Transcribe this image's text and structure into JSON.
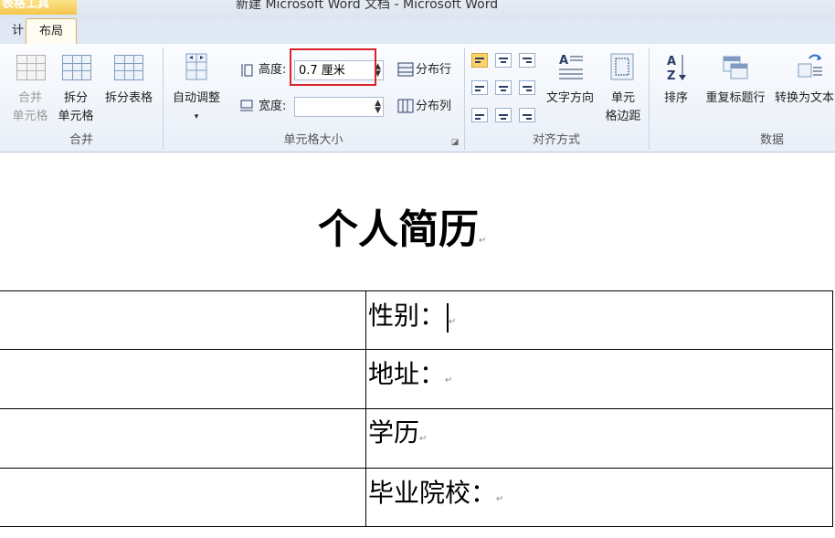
{
  "window": {
    "context_tab": "表格工具",
    "title": "新建 Microsoft Word 文档 - Microsoft Word"
  },
  "tabs": {
    "design": "计",
    "layout": "布局"
  },
  "ribbon": {
    "merge_group": {
      "label": "合并",
      "merge_cells": "合并\n单元格",
      "split_cells": "拆分\n单元格",
      "split_table": "拆分表格"
    },
    "cell_size_group": {
      "label": "单元格大小",
      "autofit": "自动调整",
      "height_label": "高度:",
      "height_value": "0.7 厘米",
      "width_label": "宽度:",
      "width_value": "",
      "distribute_rows": "分布行",
      "distribute_cols": "分布列"
    },
    "alignment_group": {
      "label": "对齐方式",
      "text_direction": "文字方向",
      "cell_margins": "单元\n格边距"
    },
    "data_group": {
      "label": "数据",
      "sort": "排序",
      "repeat_header": "重复标题行",
      "convert_to_text": "转换为文本"
    }
  },
  "document": {
    "heading": "个人简历",
    "rows": [
      "性别：",
      "地址：",
      "学历",
      "毕业院校："
    ],
    "paragraph_mark": "↵"
  }
}
